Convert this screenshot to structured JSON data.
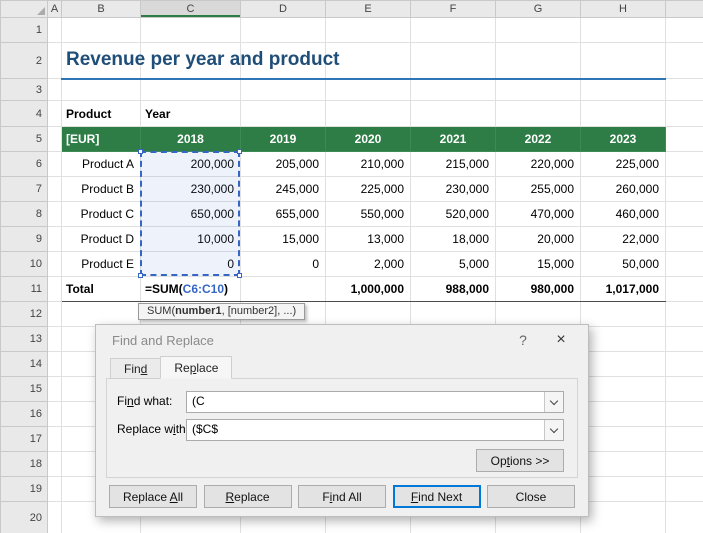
{
  "grid": {
    "columns": [
      "A",
      "B",
      "C",
      "D",
      "E",
      "F",
      "G",
      "H"
    ],
    "rows": [
      "1",
      "2",
      "3",
      "4",
      "5",
      "6",
      "7",
      "8",
      "9",
      "10",
      "11",
      "12",
      "13",
      "14",
      "15",
      "16",
      "17",
      "18",
      "19",
      "20"
    ]
  },
  "sheet": {
    "title": "Revenue per year and product",
    "product_label": "Product",
    "year_label": "Year",
    "unit_label": "[EUR]",
    "years": [
      "2018",
      "2019",
      "2020",
      "2021",
      "2022",
      "2023"
    ],
    "products": [
      {
        "name": "Product A",
        "values": [
          "200,000",
          "205,000",
          "210,000",
          "215,000",
          "220,000",
          "225,000"
        ]
      },
      {
        "name": "Product B",
        "values": [
          "230,000",
          "245,000",
          "225,000",
          "230,000",
          "255,000",
          "260,000"
        ]
      },
      {
        "name": "Product C",
        "values": [
          "650,000",
          "655,000",
          "550,000",
          "520,000",
          "470,000",
          "460,000"
        ]
      },
      {
        "name": "Product D",
        "values": [
          "10,000",
          "15,000",
          "13,000",
          "18,000",
          "20,000",
          "22,000"
        ]
      },
      {
        "name": "Product E",
        "values": [
          "0",
          "0",
          "2,000",
          "5,000",
          "15,000",
          "50,000"
        ]
      }
    ],
    "total": {
      "label": "Total",
      "formula_prefix": "=SUM(",
      "formula_ref": "C6:C10",
      "formula_suffix": ")",
      "values": [
        "1,000,000",
        "988,000",
        "980,000",
        "1,017,000"
      ],
      "selected_range": "C6:C10"
    }
  },
  "formula_tooltip": {
    "fn": "SUM(",
    "arg_bold": "number1",
    "rest": ", [number2], ...)"
  },
  "dialog": {
    "title": "Find and Replace",
    "help_label": "?",
    "close_label": "×",
    "tabs": {
      "find": "Find",
      "replace": "Replace"
    },
    "fields": {
      "find_label": "Find what:",
      "find_value": "(C",
      "replace_label": "Replace with:",
      "replace_value": "($C$"
    },
    "options_label": "Options >>",
    "buttons": {
      "replace_all": "Replace All",
      "replace": "Replace",
      "find_all": "Find All",
      "find_next": "Find Next",
      "close": "Close"
    }
  },
  "colors": {
    "header_green": "#2E7D46",
    "title_blue": "#1F4E79",
    "title_underline_blue": "#2E75B6",
    "reference_blue": "#3566C5",
    "default_button_blue": "#0078D7",
    "dialog_bg": "#F0F0F0"
  }
}
